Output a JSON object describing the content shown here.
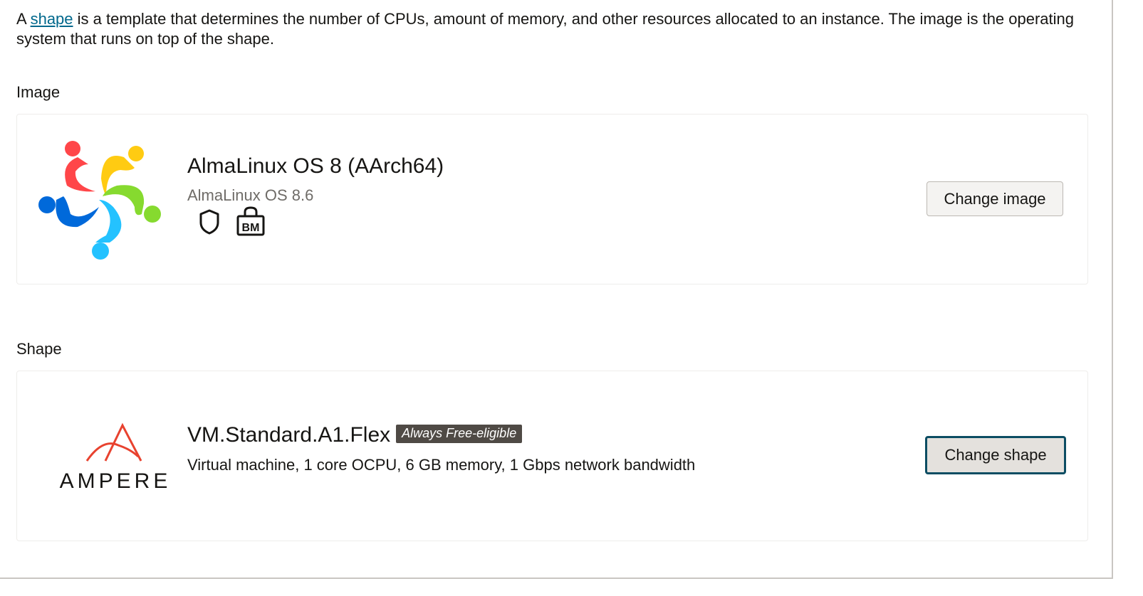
{
  "intro": {
    "prefix": "A ",
    "link": "shape",
    "suffix": " is a template that determines the number of CPUs, amount of memory, and other resources allocated to an instance. The image is the operating system that runs on top of the shape."
  },
  "image_section": {
    "label": "Image",
    "title": "AlmaLinux OS 8 (AArch64)",
    "subtitle": "AlmaLinux OS 8.6",
    "icons": [
      "shield-icon",
      "bm-lock-icon"
    ],
    "bm_text": "BM",
    "button": "Change image"
  },
  "shape_section": {
    "label": "Shape",
    "title": "VM.Standard.A1.Flex",
    "badge": "Always Free-eligible",
    "description": "Virtual machine, 1 core OCPU, 6 GB memory, 1 Gbps network bandwidth",
    "logo_text": "AMPERE",
    "button": "Change shape"
  }
}
